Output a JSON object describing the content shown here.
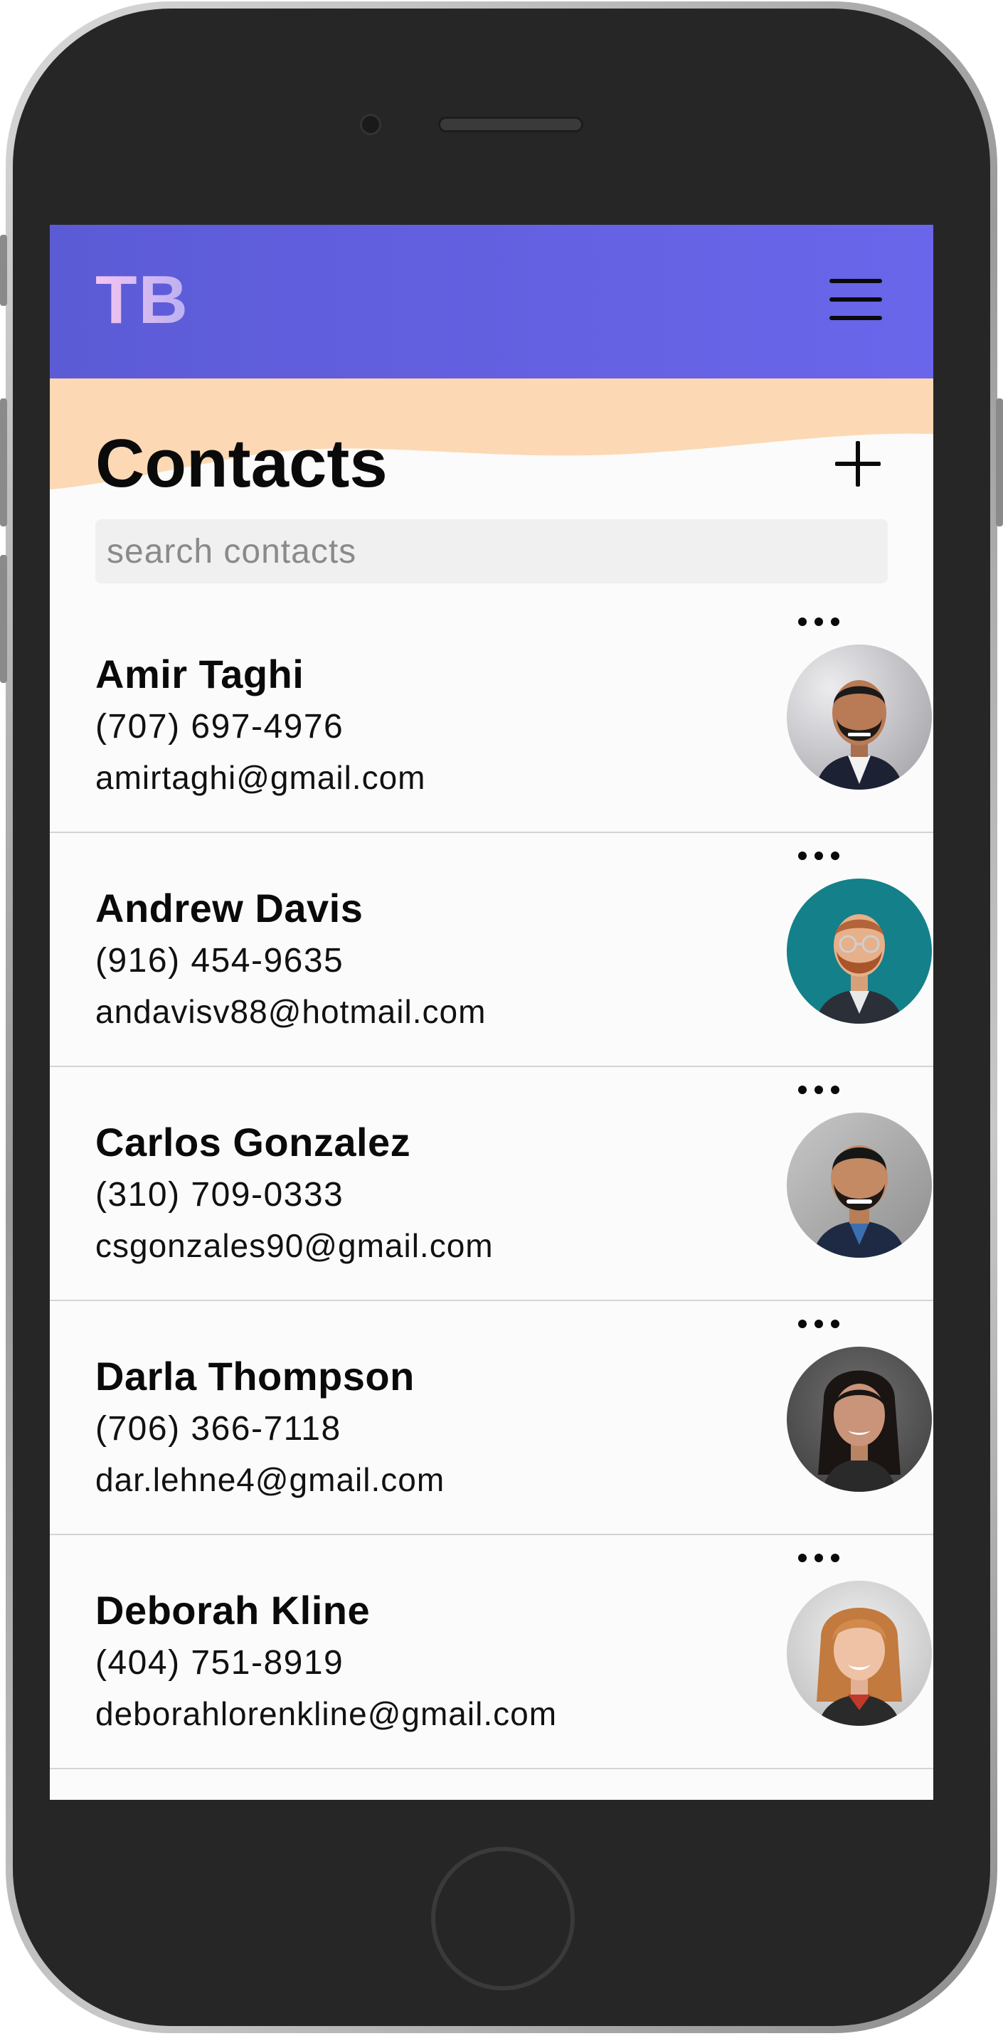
{
  "app": {
    "logo": "TB",
    "brand_gradient": [
      "#5c5bd6",
      "#6a66eb"
    ],
    "logo_gradient": [
      "#f4c4ef",
      "#b9b0f3"
    ],
    "accent_peach": "#fcd8b4"
  },
  "navbar": {
    "menu_icon": "hamburger-menu-icon"
  },
  "header": {
    "title": "Contacts",
    "add_icon": "plus-icon"
  },
  "search": {
    "placeholder": "search contacts",
    "value": ""
  },
  "contacts": [
    {
      "name": "Amir Taghi",
      "phone": "(707) 697-4976",
      "email": "amirtaghi@gmail.com",
      "avatar_bg": "#c9c9cc"
    },
    {
      "name": "Andrew Davis",
      "phone": "(916) 454-9635",
      "email": "andavisv88@hotmail.com",
      "avatar_bg": "#13808a"
    },
    {
      "name": "Carlos Gonzalez",
      "phone": "(310) 709-0333",
      "email": "csgonzales90@gmail.com",
      "avatar_bg": "#a9a9a9"
    },
    {
      "name": "Darla Thompson",
      "phone": "(706) 366-7118",
      "email": "dar.lehne4@gmail.com",
      "avatar_bg": "#5a5a5a"
    },
    {
      "name": "Deborah Kline",
      "phone": "(404) 751-8919",
      "email": "deborahlorenkline@gmail.com",
      "avatar_bg": "#d8d8d8"
    }
  ]
}
